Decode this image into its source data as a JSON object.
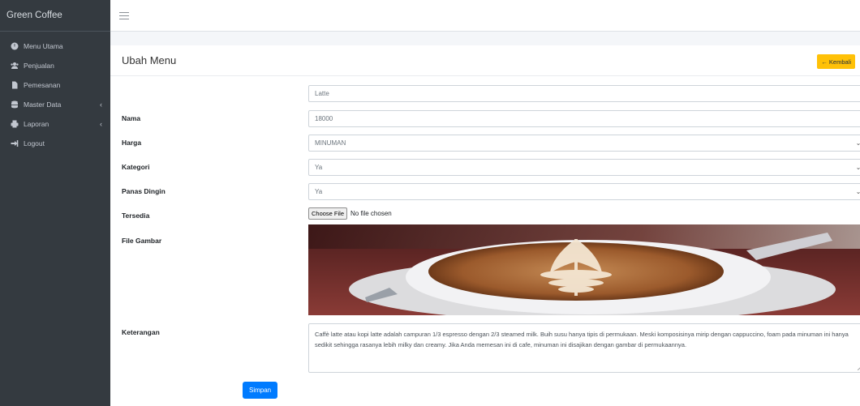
{
  "app": {
    "brand": "Green Coffee"
  },
  "sidebar": {
    "items": [
      {
        "label": "Menu Utama",
        "icon": "dashboard-icon"
      },
      {
        "label": "Penjualan",
        "icon": "users-icon"
      },
      {
        "label": "Pemesanan",
        "icon": "file-icon"
      },
      {
        "label": "Master Data",
        "icon": "database-icon",
        "chevron": "‹"
      },
      {
        "label": "Laporan",
        "icon": "printer-icon",
        "chevron": "‹"
      },
      {
        "label": "Logout",
        "icon": "sign-out-icon"
      }
    ]
  },
  "card": {
    "title": "Ubah Menu",
    "back_label": "← Kembali"
  },
  "form": {
    "nama": {
      "label": "Nama",
      "value": "Latte"
    },
    "harga": {
      "label": "Harga",
      "value": "18000"
    },
    "kategori": {
      "label": "Kategori",
      "value": "MINUMAN"
    },
    "panas_dingin": {
      "label": "Panas Dingin",
      "value": "Ya"
    },
    "tersedia": {
      "label": "Tersedia",
      "value": "Ya"
    },
    "file": {
      "label": "File Gambar",
      "button": "Choose File",
      "status": "No file chosen"
    },
    "keterangan": {
      "label": "Keterangan",
      "value": "Caffè latte atau kopi latte adalah campuran 1/3 espresso dengan 2/3 steamed milk. Buih susu hanya tipis di permukaan. Meski komposisinya mirip dengan cappuccino, foam pada minuman ini hanya sedikit sehingga rasanya lebih milky dan creamy. Jika Anda memesan ini di cafe, minuman ini disajikan dengan gambar di permukaannya."
    },
    "save_label": "Simpan"
  },
  "colors": {
    "sidebar_bg": "#343a40",
    "accent_warning": "#ffc107",
    "accent_primary": "#007bff"
  }
}
